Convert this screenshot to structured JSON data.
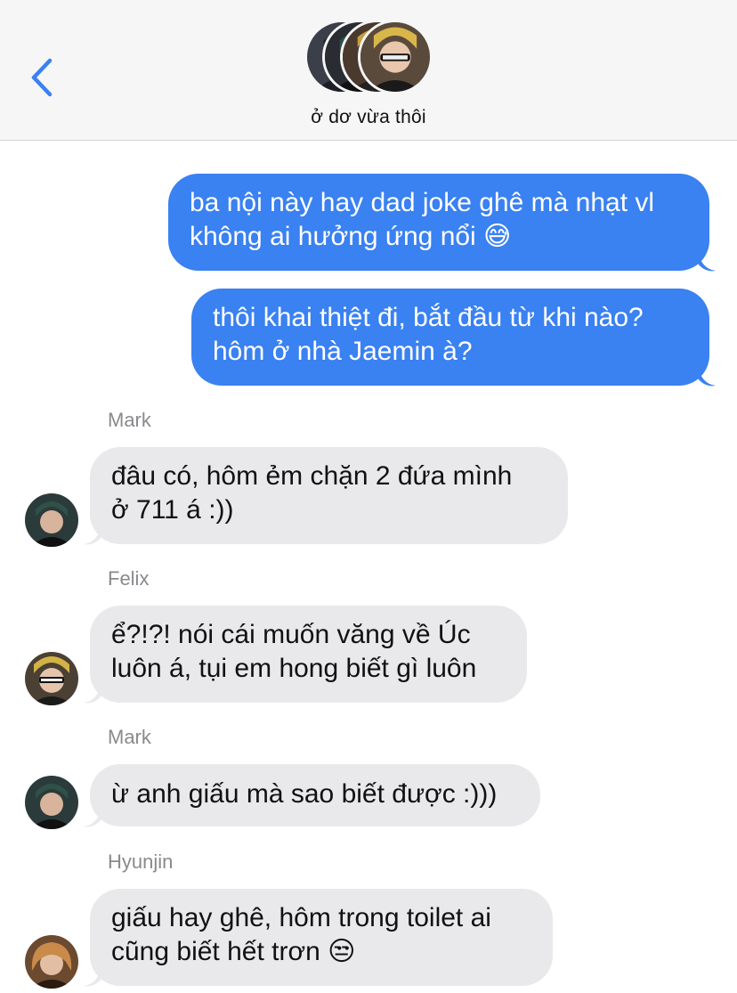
{
  "header": {
    "group_name": "ở dơ vừa thôi",
    "back_icon": "chevron-left-icon",
    "accent_color": "#3a81f1"
  },
  "messages": [
    {
      "direction": "outgoing",
      "lines": [
        "ba nội này hay dad joke ghê mà nhạt vl",
        "không ai hưởng ứng nổi 😅"
      ]
    },
    {
      "direction": "outgoing",
      "lines": [
        "thôi khai thiệt đi, bắt đầu từ khi nào?",
        "hôm ở nhà Jaemin à?"
      ]
    },
    {
      "direction": "incoming",
      "sender": "Mark",
      "lines": [
        "đâu có, hôm ẻm chặn 2 đứa mình",
        "ở 711 á :))"
      ]
    },
    {
      "direction": "incoming",
      "sender": "Felix",
      "lines": [
        "ể?!?! nói cái muốn văng về Úc",
        "luôn á, tụi em hong biết gì luôn"
      ]
    },
    {
      "direction": "incoming",
      "sender": "Mark",
      "lines": [
        "ừ anh giấu mà sao biết được :)))"
      ]
    },
    {
      "direction": "incoming",
      "sender": "Hyunjin",
      "lines": [
        "giấu hay ghê, hôm trong toilet ai",
        "cũng biết hết trơn 😒"
      ]
    }
  ],
  "colors": {
    "outgoing_bubble": "#3a81f1",
    "incoming_bubble": "#e9e9eb",
    "sender_name": "#8a8a8e"
  }
}
